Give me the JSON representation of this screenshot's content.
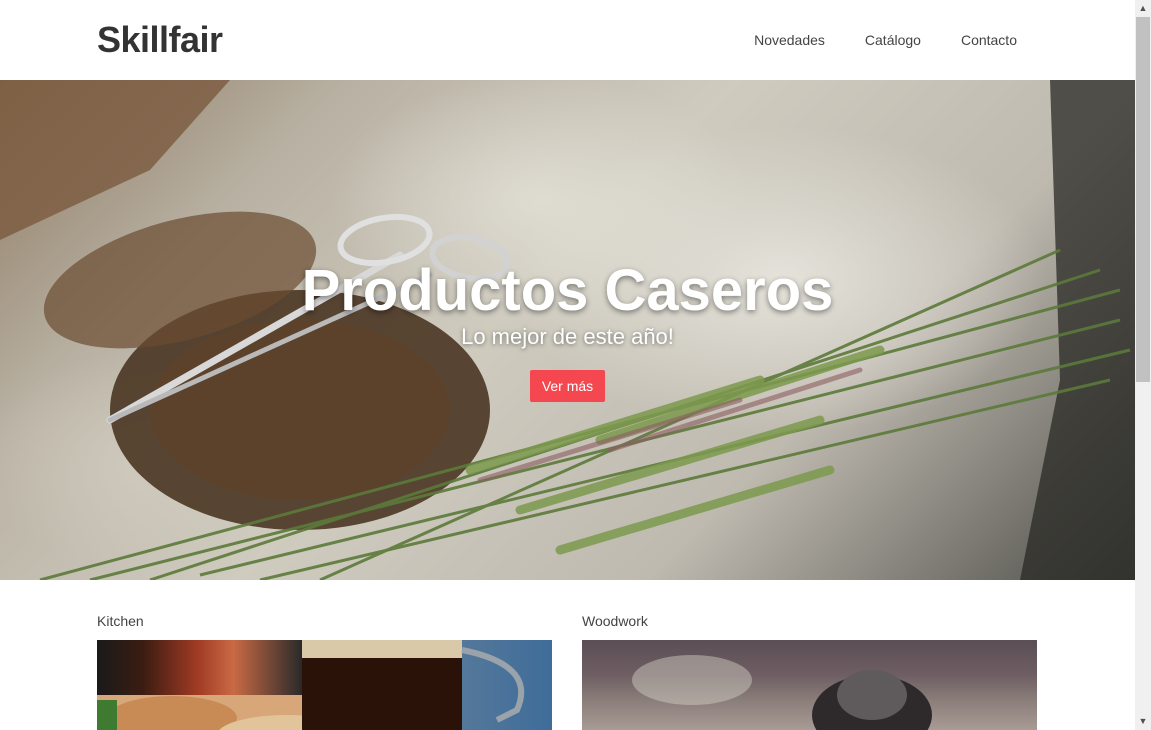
{
  "header": {
    "logo": "Skillfair",
    "nav": [
      {
        "label": "Novedades"
      },
      {
        "label": "Catálogo"
      },
      {
        "label": "Contacto"
      }
    ]
  },
  "hero": {
    "title": "Productos Caseros",
    "subtitle": "Lo mejor de este año!",
    "button_label": "Ver más",
    "button_color": "#f5474f"
  },
  "categories": [
    {
      "label": "Kitchen"
    },
    {
      "label": "Woodwork"
    }
  ],
  "scrollbar": {
    "up_icon": "chevron-up-icon",
    "down_icon": "chevron-down-icon"
  }
}
